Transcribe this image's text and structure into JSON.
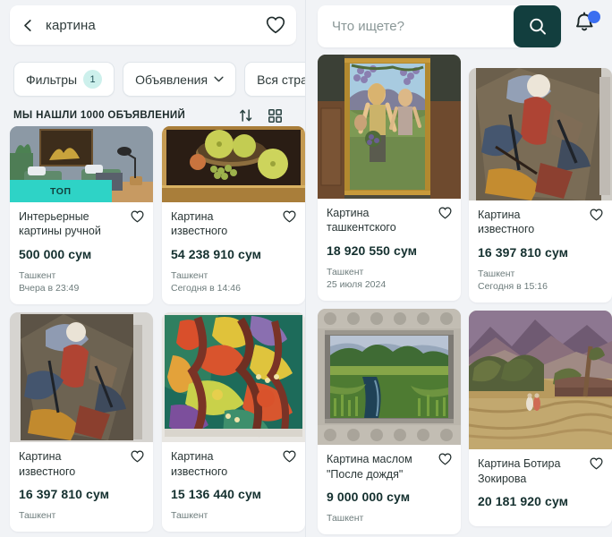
{
  "left": {
    "search": {
      "value": "картина",
      "back_icon": "chevron-left-icon",
      "favorite_icon": "heart-icon"
    },
    "chips": [
      {
        "label": "Фильтры",
        "badge": "1",
        "has_chevron": false
      },
      {
        "label": "Объявления",
        "badge": null,
        "has_chevron": true
      },
      {
        "label": "Вся страна",
        "badge": null,
        "has_chevron": false
      }
    ],
    "results_label": "МЫ НАШЛИ 1000 ОБЪЯВЛЕНИЙ",
    "sort_icon": "sort-arrows-icon",
    "view_icon": "grid-view-icon",
    "top_badge_label": "ТОП",
    "cards": [
      {
        "title": "Интерьерные\nкартины ручной",
        "price": "500 000 сум",
        "meta": "Ташкент\nВчера в 23:49",
        "badge": "ТОП",
        "favorite_icon": "heart-icon"
      },
      {
        "title": "Картина\nизвестного",
        "price": "54 238 910 сум",
        "meta": "Ташкент\nСегодня в 14:46",
        "badge": null,
        "favorite_icon": "heart-icon"
      },
      {
        "title": "Картина\nизвестного",
        "price": "16 397 810 сум",
        "meta": "Ташкент",
        "badge": null,
        "favorite_icon": "heart-icon"
      },
      {
        "title": "Картина\nизвестного",
        "price": "15 136 440 сум",
        "meta": "Ташкент",
        "badge": null,
        "favorite_icon": "heart-icon"
      }
    ]
  },
  "right": {
    "search": {
      "placeholder": "Что ищете?",
      "value": "",
      "submit_icon": "search-icon"
    },
    "bell_icon": "bell-icon",
    "bell_has_badge": true,
    "cards": [
      {
        "title": "Картина\nташкентского",
        "price": "18 920 550 сум",
        "meta": "Ташкент\n25 июля 2024",
        "favorite_icon": "heart-icon"
      },
      {
        "title": "Картина\nизвестного",
        "price": "16 397 810 сум",
        "meta": "Ташкент\nСегодня в 15:16",
        "favorite_icon": "heart-icon"
      },
      {
        "title": "Картина маслом\n\"После дождя\"",
        "price": "9 000 000 сум",
        "meta": "Ташкент",
        "favorite_icon": "heart-icon"
      },
      {
        "title": "Картина Ботира\nЗокирова",
        "price": "20 181 920 сум",
        "meta": "",
        "favorite_icon": "heart-icon"
      }
    ]
  },
  "colors": {
    "accent_dark": "#123e3e",
    "badge_top": "#2ed3c6",
    "chip_badge": "#cdf0ec",
    "notification_dot": "#3b6ef0",
    "page_bg": "#f1f3f6",
    "price_text": "#14302f",
    "meta_text": "#6c7b7b"
  }
}
